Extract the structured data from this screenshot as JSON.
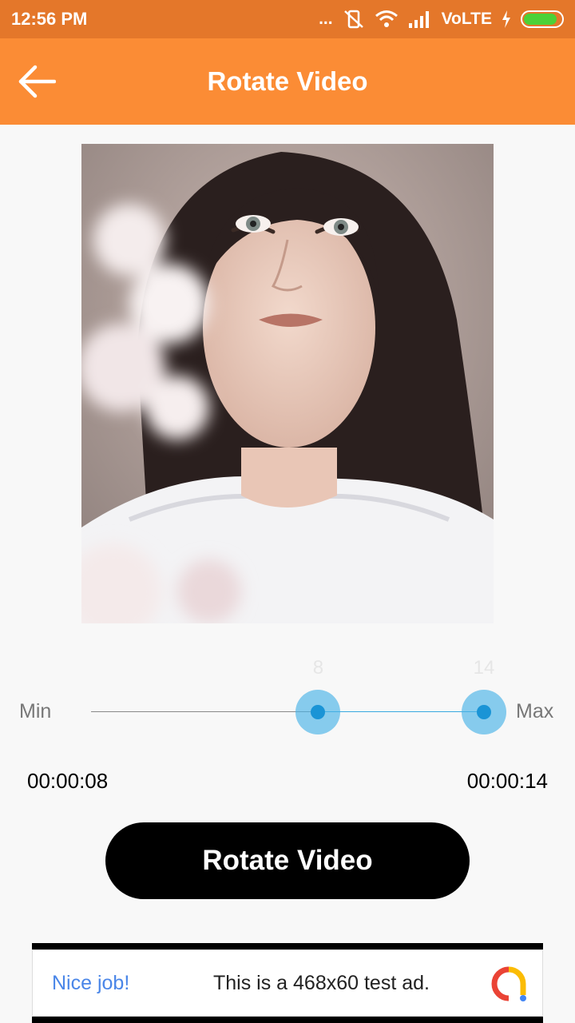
{
  "status_bar": {
    "time": "12:56 PM",
    "dots": "...",
    "network": "VoLTE",
    "icons": [
      "mute-icon",
      "wifi-icon",
      "signal-icon",
      "charging-icon",
      "battery-icon"
    ],
    "battery_level": 0.9
  },
  "app_bar": {
    "back_icon": "arrow-left-icon",
    "title": "Rotate Video"
  },
  "video": {
    "content": "portrait-photo"
  },
  "range": {
    "min_label": "Min",
    "max_label": "Max",
    "start_value": "8",
    "end_value": "14",
    "start_fraction": 0.578,
    "end_fraction": 1.0,
    "start_time": "00:00:08",
    "end_time": "00:00:14"
  },
  "action": {
    "button_label": "Rotate Video"
  },
  "ad": {
    "nice": "Nice job!",
    "text": "This is a 468x60 test ad.",
    "logo_icon": "ad-logo-icon"
  },
  "colors": {
    "status_bar": "#e4772a",
    "app_bar": "#fb8c35",
    "slider_accent": "#39a9e0",
    "button": "#000000"
  }
}
